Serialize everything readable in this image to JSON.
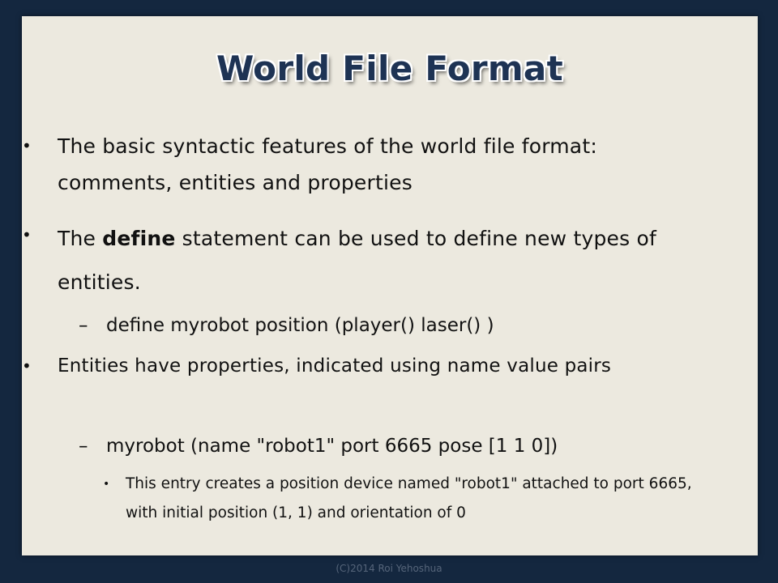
{
  "slide": {
    "title": "World File Format",
    "bullets": [
      {
        "parts": [
          "The basic syntactic features of the world file format: comments, entities and properties"
        ]
      },
      {
        "before": "The ",
        "bold": "define",
        "after": " statement can be used to define new types of entities."
      }
    ],
    "sub1": "define myrobot position (player() laser() )",
    "bullet3": "Entities have properties, indicated using name value pairs",
    "sub2": "myrobot (name \"robot1\" port 6665 pose [1 1 0])",
    "subsub": "This entry creates a position device named \"robot1\" attached to port 6665, with initial position (1, 1) and orientation of 0",
    "bullet_marker": "•",
    "dash_marker": "–"
  },
  "footer": "(C)2014 Roi Yehoshua"
}
